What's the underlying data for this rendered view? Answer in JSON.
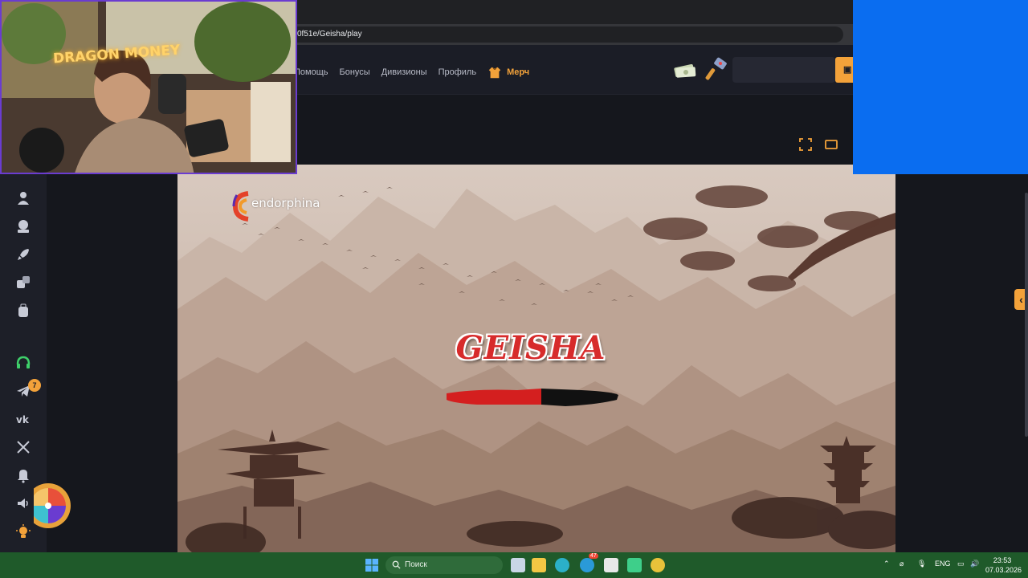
{
  "browser": {
    "url": "0f51e/Geisha/play"
  },
  "header": {
    "nav": [
      "Помощь",
      "Бонусы",
      "Дивизионы",
      "Профиль"
    ],
    "merch_label": "Мерч"
  },
  "sidebar": {
    "icons": [
      "user-icon",
      "joystick-icon",
      "rocket-icon",
      "dice-icon",
      "backpack-icon",
      "headset-icon",
      "telegram-icon",
      "vk-icon",
      "x-icon",
      "bell-icon",
      "sound-icon",
      "bulb-icon"
    ],
    "telegram_badge": "7"
  },
  "game": {
    "provider": "endorphina",
    "title": "GEISHA",
    "loading_progress": 0.55
  },
  "webcam": {
    "sign": "DRAGON MONEY",
    "pillow_text": "DRAGON MONEY"
  },
  "taskbar": {
    "search_placeholder": "Поиск",
    "language": "ENG",
    "time": "23:53",
    "date": "07.03.2026",
    "telegram_badge": "47"
  },
  "colors": {
    "accent": "#f3a23a",
    "overlay_blue": "#0a6df0",
    "taskbar": "#1f5a2a"
  }
}
